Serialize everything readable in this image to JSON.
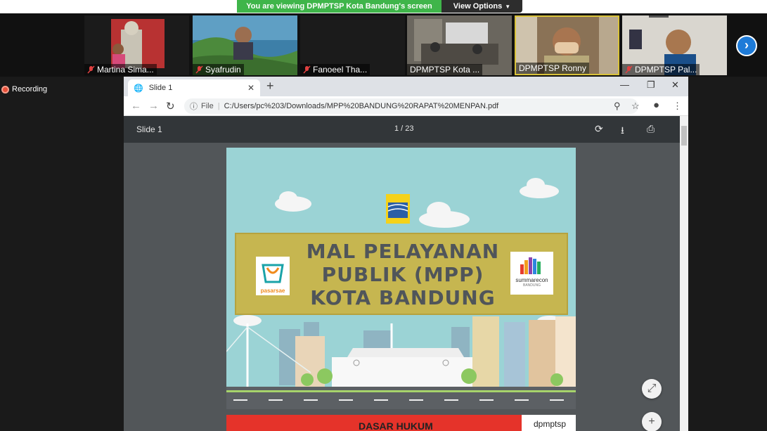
{
  "banner": {
    "sharing_text": "You are viewing DPMPTSP Kota Bandung's screen",
    "view_options_label": "View Options"
  },
  "participants": [
    {
      "name": "Martina Sima...",
      "muted": true
    },
    {
      "name": "Syafrudin",
      "muted": true
    },
    {
      "name": "Fanoeel Tha...",
      "muted": true
    },
    {
      "name": "DPMPTSP Kota ...",
      "muted": false
    },
    {
      "name": "DPMPTSP Ronny",
      "muted": false
    },
    {
      "name": "DPMPTSP Pal...",
      "muted": true
    }
  ],
  "recording": {
    "label": "Recording"
  },
  "browser": {
    "tab_title": "Slide 1",
    "url_scheme": "File",
    "url": "C:/Users/pc%203/Downloads/MPP%20BANDUNG%20RAPAT%20MENPAN.pdf"
  },
  "pdf": {
    "document_title": "Slide 1",
    "page_indicator": "1 / 23"
  },
  "slide": {
    "title_lines": [
      "MAL PELAYANAN",
      "PUBLIK (MPP)",
      "KOTA BANDUNG"
    ],
    "left_logo_text": "pasarsae",
    "right_logo_text": "summarecon",
    "right_logo_subtext": "BANDUNG"
  },
  "next_slide": {
    "heading": "DASAR HUKUM",
    "brand": "dpmptsp"
  },
  "colors": {
    "share_green": "#3fb54a",
    "sky": "#9bd3d5",
    "title_gold": "#c6b650",
    "hukum_red": "#e5332a"
  }
}
